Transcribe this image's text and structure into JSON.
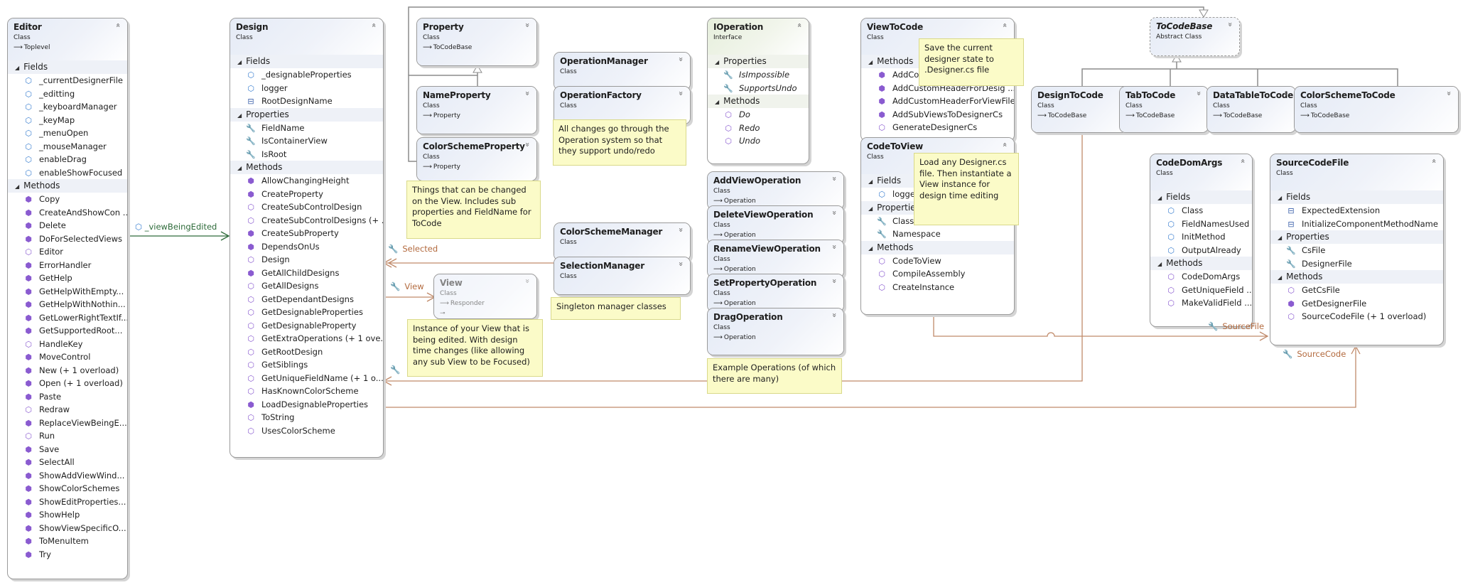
{
  "diagram": {
    "classes": {
      "editor": {
        "name": "Editor",
        "kind": "Class",
        "base": "Toplevel",
        "toggle": "collapse",
        "sections": [
          {
            "title": "Fields",
            "members": [
              {
                "icon": "private-field-icon",
                "text": "_currentDesignerFile"
              },
              {
                "icon": "private-field-icon",
                "text": "_editting"
              },
              {
                "icon": "private-field-icon",
                "text": "_keyboardManager"
              },
              {
                "icon": "private-field-icon",
                "text": "_keyMap"
              },
              {
                "icon": "private-field-icon",
                "text": "_menuOpen"
              },
              {
                "icon": "private-field-icon",
                "text": "_mouseManager"
              },
              {
                "icon": "private-field-icon",
                "text": "enableDrag"
              },
              {
                "icon": "private-field-icon",
                "text": "enableShowFocused"
              }
            ]
          },
          {
            "title": "Methods",
            "members": [
              {
                "icon": "private-method-icon",
                "text": "Copy"
              },
              {
                "icon": "private-method-icon",
                "text": "CreateAndShowCon ..."
              },
              {
                "icon": "private-method-icon",
                "text": "Delete"
              },
              {
                "icon": "private-method-icon",
                "text": "DoForSelectedViews"
              },
              {
                "icon": "public-method-icon",
                "text": "Editor"
              },
              {
                "icon": "private-method-icon",
                "text": "ErrorHandler"
              },
              {
                "icon": "private-method-icon",
                "text": "GetHelp"
              },
              {
                "icon": "private-method-icon",
                "text": "GetHelpWithEmpty..."
              },
              {
                "icon": "private-method-icon",
                "text": "GetHelpWithNothin..."
              },
              {
                "icon": "private-method-icon",
                "text": "GetLowerRightTextIf..."
              },
              {
                "icon": "private-method-icon",
                "text": "GetSupportedRoot..."
              },
              {
                "icon": "public-method-icon",
                "text": "HandleKey"
              },
              {
                "icon": "private-method-icon",
                "text": "MoveControl"
              },
              {
                "icon": "private-method-icon",
                "text": "New (+ 1 overload)"
              },
              {
                "icon": "private-method-icon",
                "text": "Open (+ 1 overload)"
              },
              {
                "icon": "private-method-icon",
                "text": "Paste"
              },
              {
                "icon": "public-method-icon",
                "text": "Redraw"
              },
              {
                "icon": "private-method-icon",
                "text": "ReplaceViewBeingE..."
              },
              {
                "icon": "public-method-icon",
                "text": "Run"
              },
              {
                "icon": "private-method-icon",
                "text": "Save"
              },
              {
                "icon": "private-method-icon",
                "text": "SelectAll"
              },
              {
                "icon": "private-method-icon",
                "text": "ShowAddViewWind..."
              },
              {
                "icon": "private-method-icon",
                "text": "ShowColorSchemes"
              },
              {
                "icon": "private-method-icon",
                "text": "ShowEditProperties..."
              },
              {
                "icon": "private-method-icon",
                "text": "ShowHelp"
              },
              {
                "icon": "private-method-icon",
                "text": "ShowViewSpecificO..."
              },
              {
                "icon": "private-method-icon",
                "text": "ToMenuItem"
              },
              {
                "icon": "private-method-icon",
                "text": "Try"
              }
            ]
          }
        ]
      },
      "design": {
        "name": "Design",
        "kind": "Class",
        "toggle": "collapse",
        "sections": [
          {
            "title": "Fields",
            "members": [
              {
                "icon": "private-field-icon",
                "text": "_designableProperties"
              },
              {
                "icon": "private-field-icon",
                "text": "logger"
              },
              {
                "icon": "constant-icon",
                "text": "RootDesignName"
              }
            ]
          },
          {
            "title": "Properties",
            "members": [
              {
                "icon": "property-icon",
                "text": "FieldName"
              },
              {
                "icon": "property-icon",
                "text": "IsContainerView"
              },
              {
                "icon": "property-icon",
                "text": "IsRoot"
              }
            ]
          },
          {
            "title": "Methods",
            "members": [
              {
                "icon": "private-method-icon",
                "text": "AllowChangingHeight"
              },
              {
                "icon": "private-method-icon",
                "text": "CreateProperty"
              },
              {
                "icon": "public-method-icon",
                "text": "CreateSubControlDesign"
              },
              {
                "icon": "public-method-icon",
                "text": "CreateSubControlDesigns  (+ ..."
              },
              {
                "icon": "private-method-icon",
                "text": "CreateSubProperty"
              },
              {
                "icon": "private-method-icon",
                "text": "DependsOnUs"
              },
              {
                "icon": "public-method-icon",
                "text": "Design"
              },
              {
                "icon": "private-method-icon",
                "text": "GetAllChildDesigns"
              },
              {
                "icon": "public-method-icon",
                "text": "GetAllDesigns"
              },
              {
                "icon": "public-method-icon",
                "text": "GetDependantDesigns"
              },
              {
                "icon": "public-method-icon",
                "text": "GetDesignableProperties"
              },
              {
                "icon": "public-method-icon",
                "text": "GetDesignableProperty"
              },
              {
                "icon": "public-method-icon",
                "text": "GetExtraOperations  (+ 1 ove..."
              },
              {
                "icon": "public-method-icon",
                "text": "GetRootDesign"
              },
              {
                "icon": "public-method-icon",
                "text": "GetSiblings"
              },
              {
                "icon": "public-method-icon",
                "text": "GetUniqueFieldName  (+ 1 o..."
              },
              {
                "icon": "public-method-icon",
                "text": "HasKnownColorScheme"
              },
              {
                "icon": "protected-method-icon",
                "text": "LoadDesignableProperties"
              },
              {
                "icon": "public-method-icon",
                "text": "ToString"
              },
              {
                "icon": "public-method-icon",
                "text": "UsesColorScheme"
              }
            ]
          }
        ]
      },
      "property": {
        "name": "Property",
        "kind": "Class",
        "base": "ToCodeBase",
        "toggle": "expand"
      },
      "nameProperty": {
        "name": "NameProperty",
        "kind": "Class",
        "base": "Property",
        "toggle": "expand"
      },
      "colorSchemeProperty": {
        "name": "ColorSchemeProperty",
        "kind": "Class",
        "base": "Property",
        "toggle": "expand"
      },
      "operationManager": {
        "name": "OperationManager",
        "kind": "Class",
        "toggle": "expand"
      },
      "operationFactory": {
        "name": "OperationFactory",
        "kind": "Class",
        "toggle": "expand"
      },
      "colorSchemeManager": {
        "name": "ColorSchemeManager",
        "kind": "Class",
        "toggle": "expand"
      },
      "selectionManager": {
        "name": "SelectionManager",
        "kind": "Class",
        "toggle": "expand"
      },
      "view": {
        "name": "View",
        "kind": "Class",
        "base": "Responder",
        "toggle": "expand"
      },
      "iOperation": {
        "name": "IOperation",
        "kind": "Interface",
        "toggle": "collapse",
        "sections": [
          {
            "title": "Properties",
            "members": [
              {
                "icon": "property-icon",
                "text": "IsImpossible"
              },
              {
                "icon": "property-icon",
                "text": "SupportsUndo"
              }
            ]
          },
          {
            "title": "Methods",
            "members": [
              {
                "icon": "public-method-icon",
                "text": "Do"
              },
              {
                "icon": "public-method-icon",
                "text": "Redo"
              },
              {
                "icon": "public-method-icon",
                "text": "Undo"
              }
            ]
          }
        ]
      },
      "addViewOperation": {
        "name": "AddViewOperation",
        "kind": "Class",
        "base": "Operation",
        "toggle": "expand"
      },
      "deleteViewOperation": {
        "name": "DeleteViewOperation",
        "kind": "Class",
        "base": "Operation",
        "toggle": "expand"
      },
      "renameViewOperation": {
        "name": "RenameViewOperation",
        "kind": "Class",
        "base": "Operation",
        "toggle": "expand"
      },
      "setPropertyOperation": {
        "name": "SetPropertyOperation",
        "kind": "Class",
        "base": "Operation",
        "toggle": "expand"
      },
      "dragOperation": {
        "name": "DragOperation",
        "kind": "Class",
        "base": "Operation",
        "toggle": "expand"
      },
      "viewToCode": {
        "name": "ViewToCode",
        "kind": "Class",
        "toggle": "collapse",
        "sections": [
          {
            "title": "Methods",
            "members": [
              {
                "icon": "private-method-icon",
                "text": "AddCo"
              },
              {
                "icon": "private-method-icon",
                "text": "AddCustomHeaderForDesig ..."
              },
              {
                "icon": "private-method-icon",
                "text": "AddCustomHeaderForViewFile"
              },
              {
                "icon": "private-method-icon",
                "text": "AddSubViewsToDesignerCs"
              },
              {
                "icon": "public-method-icon",
                "text": "GenerateDesignerCs"
              }
            ]
          }
        ]
      },
      "codeToView": {
        "name": "CodeToView",
        "kind": "Class",
        "toggle": "collapse",
        "sections": [
          {
            "title": "Fields",
            "members": [
              {
                "icon": "private-field-icon",
                "text": "logge"
              }
            ]
          },
          {
            "title": "Properties",
            "members": [
              {
                "icon": "property-icon",
                "text": "ClassName"
              },
              {
                "icon": "property-icon",
                "text": "Namespace"
              }
            ]
          },
          {
            "title": "Methods",
            "members": [
              {
                "icon": "public-method-icon",
                "text": "CodeToView"
              },
              {
                "icon": "public-method-icon",
                "text": "CompileAssembly"
              },
              {
                "icon": "public-method-icon",
                "text": "CreateInstance"
              }
            ]
          }
        ]
      },
      "toCodeBase": {
        "name": "ToCodeBase",
        "kind": "Abstract Class",
        "toggle": "expand"
      },
      "designToCode": {
        "name": "DesignToCode",
        "kind": "Class",
        "base": "ToCodeBase",
        "toggle": "expand"
      },
      "tabToCode": {
        "name": "TabToCode",
        "kind": "Class",
        "base": "ToCodeBase",
        "toggle": "expand"
      },
      "dataTableToCode": {
        "name": "DataTableToCode",
        "kind": "Class",
        "base": "ToCodeBase",
        "toggle": "expand"
      },
      "colorSchemeToCode": {
        "name": "ColorSchemeToCode",
        "kind": "Class",
        "base": "ToCodeBase",
        "toggle": "expand"
      },
      "codeDomArgs": {
        "name": "CodeDomArgs",
        "kind": "Class",
        "toggle": "collapse",
        "sections": [
          {
            "title": "Fields",
            "members": [
              {
                "icon": "public-field-icon",
                "text": "Class"
              },
              {
                "icon": "public-field-icon",
                "text": "FieldNamesUsed"
              },
              {
                "icon": "public-field-icon",
                "text": "InitMethod"
              },
              {
                "icon": "public-field-icon",
                "text": "OutputAlready"
              }
            ]
          },
          {
            "title": "Methods",
            "members": [
              {
                "icon": "public-method-icon",
                "text": "CodeDomArgs"
              },
              {
                "icon": "public-method-icon",
                "text": "GetUniqueField ..."
              },
              {
                "icon": "public-method-icon",
                "text": "MakeValidField ..."
              }
            ]
          }
        ]
      },
      "sourceCodeFile": {
        "name": "SourceCodeFile",
        "kind": "Class",
        "toggle": "collapse",
        "sections": [
          {
            "title": "Fields",
            "members": [
              {
                "icon": "constant-icon",
                "text": "ExpectedExtension"
              },
              {
                "icon": "constant-icon",
                "text": "InitializeComponentMethodName"
              }
            ]
          },
          {
            "title": "Properties",
            "members": [
              {
                "icon": "property-icon",
                "text": "CsFile"
              },
              {
                "icon": "property-icon",
                "text": "DesignerFile"
              }
            ]
          },
          {
            "title": "Methods",
            "members": [
              {
                "icon": "public-method-icon",
                "text": "GetCsFile"
              },
              {
                "icon": "private-method-icon",
                "text": "GetDesignerFile"
              },
              {
                "icon": "public-method-icon",
                "text": "SourceCodeFile (+ 1 overload)"
              }
            ]
          }
        ]
      }
    },
    "notes": {
      "operations": "All changes go through the Operation system so that they support undo/redo",
      "properties": "Things that can be changed on the View.  Includes sub properties and FieldName for ToCode",
      "singletons": "Singleton manager classes",
      "viewInstance": "Instance of your View that is being edited.  With design time changes (like allowing any sub View to be Focused)",
      "exampleOps": "Example Operations (of which there are many)",
      "viewToCode": "Save the current designer state to .Designer.cs file",
      "codeToView": "Load any Designer.cs file.  Then instantiate a View instance for design time editing"
    },
    "associations": {
      "viewBeingEdited": "_viewBeingEdited",
      "selected": "Selected",
      "view": "View",
      "sourceFile": "SourceFile",
      "sourceCode": "SourceCode"
    },
    "icons": {
      "collapse": "«",
      "expand": "»",
      "section_toggle": "◢",
      "inherits": "→"
    },
    "colors": {
      "association_orange": "#c08a6a",
      "association_green": "#2e6b3a",
      "inheritance_gray": "#8c8c8c",
      "note_fill": "#fbfbc8"
    }
  }
}
